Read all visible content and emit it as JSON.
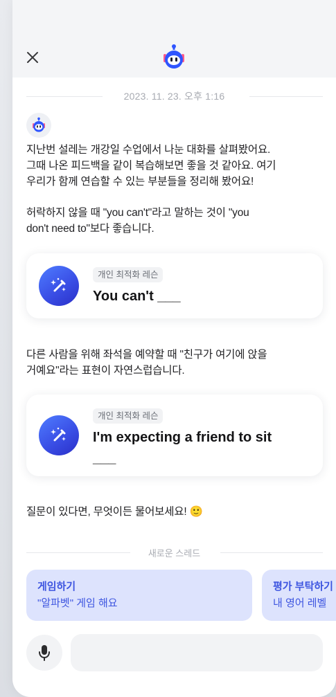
{
  "header": {
    "close_icon": "close-icon",
    "logo_icon": "robot-icon"
  },
  "chat": {
    "date": "2023. 11. 23. 오후 1:16",
    "bot_avatar_icon": "robot-icon",
    "intro_lines": [
      "지난번 설레는 개강일 수업에서 나눈 대화를 살펴봤어요.",
      "그때 나온 피드백을 같이 복습해보면 좋을 것 같아요. 여기",
      "우리가 함께 연습할 수 있는 부분들을 정리해 봤어요!"
    ],
    "feedback1_lines": [
      "허락하지 않을 때 \"you can't\"라고 말하는 것이 \"you",
      "don't need to\"보다 좋습니다."
    ],
    "lesson1": {
      "tag": "개인 최적화 레슨",
      "title": "You can't ___",
      "icon": "magic-wand-icon"
    },
    "feedback2_lines": [
      "다른 사람을 위해 좌석을 예약할 때 \"친구가 여기에 앉을",
      "거예요\"라는 표현이 자연스럽습니다."
    ],
    "lesson2": {
      "tag": "개인 최적화 레슨",
      "title_lines": [
        "I'm expecting a friend to sit",
        "___"
      ],
      "icon": "magic-wand-icon"
    },
    "closing": "질문이 있다면, 무엇이든 물어보세요! 🙂"
  },
  "threads": {
    "label": "새로운 스레드",
    "chips": [
      {
        "title": "게임하기",
        "subtitle": "\"알파벳\" 게임 해요"
      },
      {
        "title": "평가 부탁하기",
        "subtitle": "내 영어 레벨"
      }
    ]
  },
  "composer": {
    "mic_icon": "microphone-icon",
    "input_value": "",
    "input_placeholder": ""
  },
  "colors": {
    "accent": "#3d55e0",
    "chip_bg": "#dde3fd",
    "header_bg": "#f4f5f7"
  }
}
